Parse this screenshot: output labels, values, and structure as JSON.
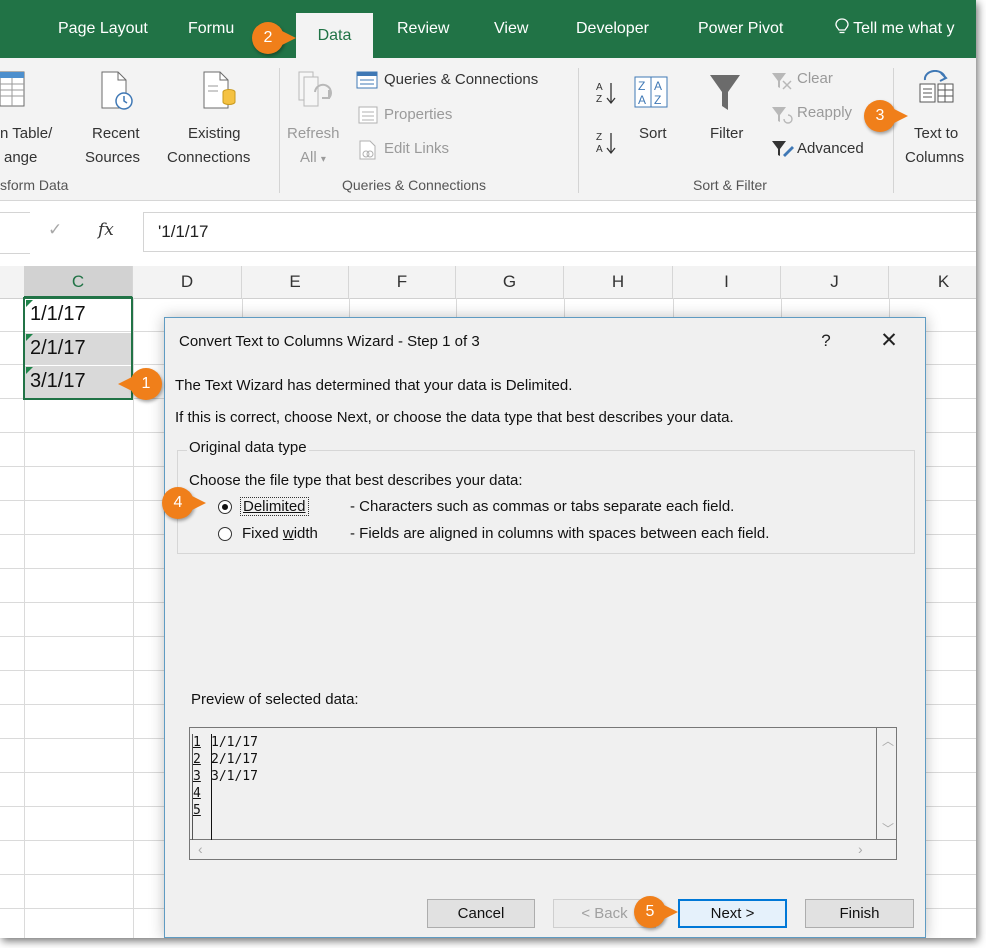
{
  "ribbon_tabs": {
    "page_layout": "Page Layout",
    "formulas": "Formu",
    "data": "Data",
    "review": "Review",
    "view": "View",
    "developer": "Developer",
    "power_pivot": "Power Pivot",
    "tell_me": "Tell me what y"
  },
  "ribbon": {
    "from_table_1": "n Table/",
    "from_table_2": "ange",
    "recent_sources_1": "Recent",
    "recent_sources_2": "Sources",
    "existing_connections_1": "Existing",
    "existing_connections_2": "Connections",
    "refresh_all_1": "Refresh",
    "refresh_all_2": "All",
    "queries_connections": "Queries & Connections",
    "properties": "Properties",
    "edit_links": "Edit Links",
    "sort": "Sort",
    "filter": "Filter",
    "clear": "Clear",
    "reapply": "Reapply",
    "advanced": "Advanced",
    "text_to_columns_1": "Text to",
    "text_to_columns_2": "Columns",
    "group_transform": "sform Data",
    "group_queries": "Queries & Connections",
    "group_sort_filter": "Sort & Filter"
  },
  "formula_bar": {
    "check": "✓",
    "fx": "fx",
    "value": "'1/1/17"
  },
  "grid": {
    "columns": [
      "C",
      "D",
      "E",
      "F",
      "G",
      "H",
      "I",
      "J",
      "K"
    ],
    "cells": [
      "1/1/17",
      "2/1/17",
      "3/1/17"
    ]
  },
  "dialog": {
    "title": "Convert Text to Columns Wizard - Step 1 of 3",
    "help": "?",
    "close": "✕",
    "intro_1": "The Text Wizard has determined that your data is Delimited.",
    "intro_2": "If this is correct, choose Next, or choose the data type that best describes your data.",
    "group_legend": "Original data type",
    "choose_label": "Choose the file type that best describes your data:",
    "delimited_label": "Delimited",
    "delimited_desc": "- Characters such as commas or tabs separate each field.",
    "fixed_width_label_pre": "Fixed ",
    "fixed_width_label_u": "w",
    "fixed_width_label_post": "idth",
    "fixed_width_desc": "- Fields are aligned in columns with spaces between each field.",
    "selected_type": "Delimited",
    "preview_label": "Preview of selected data:",
    "preview_rows": [
      {
        "num": "1",
        "text": "1/1/17"
      },
      {
        "num": "2",
        "text": "2/1/17"
      },
      {
        "num": "3",
        "text": "3/1/17"
      },
      {
        "num": "4",
        "text": ""
      },
      {
        "num": "5",
        "text": ""
      }
    ],
    "buttons": {
      "cancel": "Cancel",
      "back": "< Back",
      "next": "Next >",
      "finish": "Finish"
    }
  },
  "callouts": [
    "1",
    "2",
    "3",
    "4",
    "5"
  ],
  "colors": {
    "excel_green": "#217346",
    "callout_orange": "#f07f1a",
    "dialog_border": "#5f9bc2"
  }
}
